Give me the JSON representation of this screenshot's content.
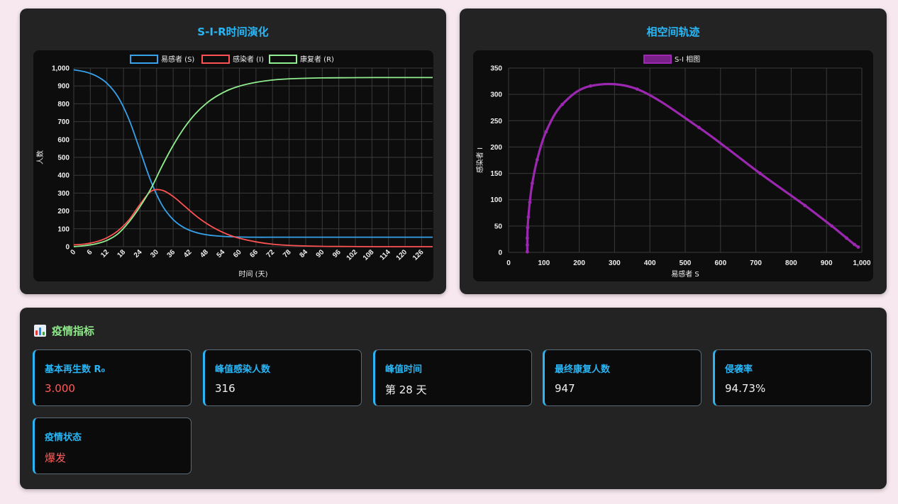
{
  "left_panel": {
    "title": "S-I-R时间演化"
  },
  "right_panel": {
    "title": "相空间轨迹"
  },
  "metrics": {
    "title": "疫情指标",
    "icon": "bar-chart-icon",
    "cards": [
      {
        "label": "基本再生数 R₀",
        "value": "3.000",
        "value_color": "#ff5c5c"
      },
      {
        "label": "峰值感染人数",
        "value": "316",
        "value_color": "#f2f2f2"
      },
      {
        "label": "峰值时间",
        "value": "第 28 天",
        "value_color": "#f2f2f2"
      },
      {
        "label": "最终康复人数",
        "value": "947",
        "value_color": "#f2f2f2"
      },
      {
        "label": "侵袭率",
        "value": "94.73%",
        "value_color": "#f2f2f2"
      },
      {
        "label": "疫情状态",
        "value": "爆发",
        "value_color": "#ff5c5c"
      }
    ]
  },
  "chart_data": [
    {
      "type": "line",
      "title": "",
      "xlabel": "时间 (天)",
      "ylabel": "人数",
      "xlim": [
        0,
        130
      ],
      "ylim": [
        0,
        1000
      ],
      "x_ticks": [
        0,
        6,
        12,
        18,
        24,
        30,
        36,
        42,
        48,
        54,
        60,
        66,
        72,
        78,
        84,
        90,
        96,
        102,
        108,
        114,
        120,
        126
      ],
      "y_ticks": [
        0,
        100,
        200,
        300,
        400,
        500,
        600,
        700,
        800,
        900,
        1000
      ],
      "y_tick_labels": [
        "0",
        "100",
        "200",
        "300",
        "400",
        "500",
        "600",
        "700",
        "800",
        "900",
        "1,000"
      ],
      "legend_position": "top-center",
      "grid": true,
      "x": [
        0,
        4,
        8,
        12,
        16,
        20,
        24,
        28,
        32,
        36,
        40,
        44,
        48,
        52,
        56,
        60,
        66,
        72,
        80,
        90,
        100,
        110,
        120,
        130
      ],
      "series": [
        {
          "name": "易感者 (S)",
          "color": "#36a2eb",
          "values": [
            990,
            979,
            957,
            915,
            839,
            712,
            539,
            364,
            232,
            152,
            106,
            81,
            67,
            60,
            56,
            54,
            53,
            53,
            53,
            53,
            53,
            53,
            53,
            53
          ]
        },
        {
          "name": "感染者 (I)",
          "color": "#ff5252",
          "values": [
            10,
            15,
            27,
            50,
            89,
            150,
            237,
            310,
            316,
            281,
            229,
            176,
            131,
            95,
            67,
            47,
            27,
            14,
            6,
            2,
            1,
            0,
            0,
            0
          ]
        },
        {
          "name": "康复者 (R)",
          "color": "#90ee90",
          "values": [
            0,
            6,
            16,
            35,
            72,
            138,
            224,
            326,
            452,
            567,
            665,
            743,
            802,
            845,
            877,
            899,
            920,
            933,
            941,
            945,
            946,
            947,
            947,
            947
          ]
        }
      ]
    },
    {
      "type": "scatter",
      "title": "",
      "xlabel": "易感者 S",
      "ylabel": "感染者 I",
      "xlim": [
        0,
        1000
      ],
      "ylim": [
        0,
        350
      ],
      "x_ticks": [
        0,
        100,
        200,
        300,
        400,
        500,
        600,
        700,
        800,
        900,
        1000
      ],
      "x_tick_labels": [
        "0",
        "100",
        "200",
        "300",
        "400",
        "500",
        "600",
        "700",
        "800",
        "900",
        "1,000"
      ],
      "y_ticks": [
        0,
        50,
        100,
        150,
        200,
        250,
        300,
        350
      ],
      "legend_position": "top-center",
      "grid": true,
      "series": [
        {
          "name": "S-I 相图",
          "color": "#9c27b0",
          "x": [
            990,
            979,
            957,
            915,
            839,
            712,
            539,
            364,
            232,
            152,
            106,
            81,
            67,
            60,
            56,
            54,
            53,
            53,
            53
          ],
          "y": [
            10,
            15,
            27,
            50,
            89,
            150,
            237,
            310,
            316,
            281,
            229,
            176,
            131,
            95,
            67,
            47,
            27,
            14,
            1
          ]
        }
      ]
    }
  ]
}
